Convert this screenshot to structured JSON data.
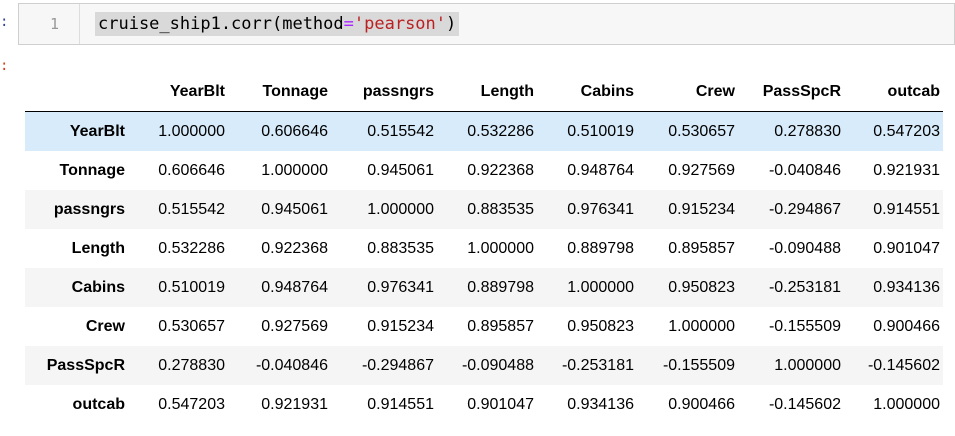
{
  "prompts": {
    "in": ":",
    "out": ":"
  },
  "code_cell": {
    "line_number": "1",
    "code": {
      "prefix": "cruise_ship1.corr(method",
      "op": "=",
      "str": "'pearson'",
      "suffix": ")"
    }
  },
  "table": {
    "columns": [
      "YearBlt",
      "Tonnage",
      "passngrs",
      "Length",
      "Cabins",
      "Crew",
      "PassSpcR",
      "outcab"
    ],
    "rows": [
      {
        "label": "YearBlt",
        "values": [
          "1.000000",
          "0.606646",
          "0.515542",
          "0.532286",
          "0.510019",
          "0.530657",
          "0.278830",
          "0.547203"
        ]
      },
      {
        "label": "Tonnage",
        "values": [
          "0.606646",
          "1.000000",
          "0.945061",
          "0.922368",
          "0.948764",
          "0.927569",
          "-0.040846",
          "0.921931"
        ]
      },
      {
        "label": "passngrs",
        "values": [
          "0.515542",
          "0.945061",
          "1.000000",
          "0.883535",
          "0.976341",
          "0.915234",
          "-0.294867",
          "0.914551"
        ]
      },
      {
        "label": "Length",
        "values": [
          "0.532286",
          "0.922368",
          "0.883535",
          "1.000000",
          "0.889798",
          "0.895857",
          "-0.090488",
          "0.901047"
        ]
      },
      {
        "label": "Cabins",
        "values": [
          "0.510019",
          "0.948764",
          "0.976341",
          "0.889798",
          "1.000000",
          "0.950823",
          "-0.253181",
          "0.934136"
        ]
      },
      {
        "label": "Crew",
        "values": [
          "0.530657",
          "0.927569",
          "0.915234",
          "0.895857",
          "0.950823",
          "1.000000",
          "-0.155509",
          "0.900466"
        ]
      },
      {
        "label": "PassSpcR",
        "values": [
          "0.278830",
          "-0.040846",
          "-0.294867",
          "-0.090488",
          "-0.253181",
          "-0.155509",
          "1.000000",
          "-0.145602"
        ]
      },
      {
        "label": "outcab",
        "values": [
          "0.547203",
          "0.921931",
          "0.914551",
          "0.901047",
          "0.934136",
          "0.900466",
          "-0.145602",
          "1.000000"
        ]
      }
    ],
    "highlighted_row": 0
  },
  "colors": {
    "in_prompt": "#303f9f",
    "out_prompt": "#d84315",
    "code_string": "#ba2121",
    "code_operator": "#aa22ff",
    "row_highlight": "#d7ebfa",
    "row_stripe": "#f5f5f5"
  }
}
